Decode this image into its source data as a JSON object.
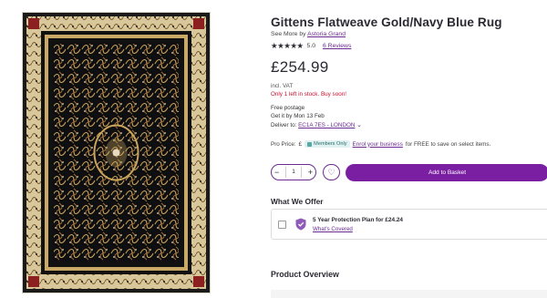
{
  "product": {
    "title": "Gittens Flatweave Gold/Navy Blue Rug",
    "see_more_prefix": "See More by ",
    "brand": "Astoria Grand",
    "stars": "★★★★★",
    "rating": "5.0",
    "reviews": "6 Reviews",
    "price": "£254.99",
    "vat": "incl. VAT",
    "stock": "Only 1 left in stock. Buy soon!"
  },
  "shipping": {
    "free": "Free postage",
    "eta": "Get it by Mon 13 Feb",
    "deliver_prefix": "Deliver to: ",
    "postcode": "EC1A 7ES - LONDON"
  },
  "pro": {
    "label": "Pro Price:",
    "currency": "£",
    "badge": "Members Only",
    "link": "Enrol your business",
    "suffix": "for FREE to save on select items."
  },
  "cart": {
    "minus": "−",
    "quantity": "1",
    "plus": "+",
    "wishlist_icon": "heart-icon",
    "add_to_basket": "Add to Basket"
  },
  "offer": {
    "heading": "What We Offer",
    "plan": "5 Year Protection Plan for £24.24",
    "link": "What's Covered"
  },
  "overview": {
    "heading": "Product Overview"
  },
  "colors": {
    "accent": "#7b1fa2",
    "link": "#6b2c91",
    "stock": "#c8102e",
    "rug_field": "#0f0f12",
    "rug_gold": "#c9a45a",
    "rug_cream": "#e8dcc0"
  }
}
